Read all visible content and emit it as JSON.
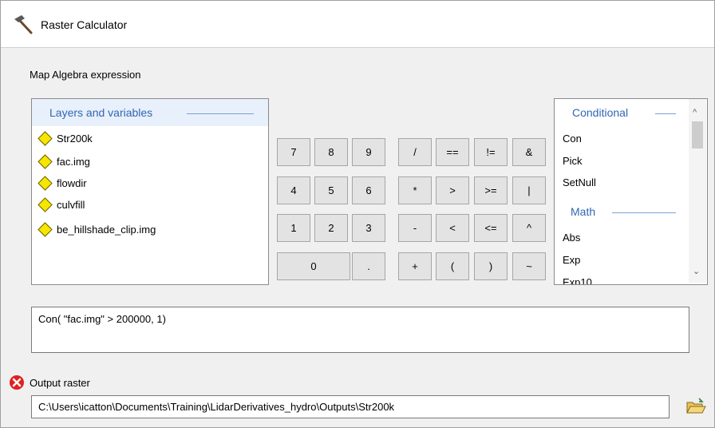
{
  "window": {
    "title": "Raster Calculator",
    "title_icon": "hammer-icon"
  },
  "expression_label": "Map Algebra expression",
  "layers": {
    "header": "Layers and variables",
    "items": [
      "Str200k",
      "fac.img",
      "flowdir",
      "culvfill",
      "be_hillshade_clip.img"
    ]
  },
  "buttons": {
    "row1": [
      "7",
      "8",
      "9",
      "/",
      "==",
      "!=",
      "&"
    ],
    "row2": [
      "4",
      "5",
      "6",
      "*",
      ">",
      ">=",
      "|"
    ],
    "row3": [
      "1",
      "2",
      "3",
      "-",
      "<",
      "<=",
      "^"
    ],
    "row4": [
      "0",
      ".",
      "+",
      "(",
      ")",
      "~"
    ]
  },
  "functions": {
    "conditional_header": "Conditional",
    "conditional": [
      "Con",
      "Pick",
      "SetNull"
    ],
    "math_header": "Math",
    "math": [
      "Abs",
      "Exp",
      "Exp10"
    ]
  },
  "expression_value": "Con( \"fac.img\" > 200000, 1)",
  "output": {
    "label": "Output raster",
    "error_icon": "error-icon",
    "path": "C:\\Users\\icatton\\Documents\\Training\\LidarDerivatives_hydro\\Outputs\\Str200k",
    "browse_icon": "folder-open-icon"
  }
}
